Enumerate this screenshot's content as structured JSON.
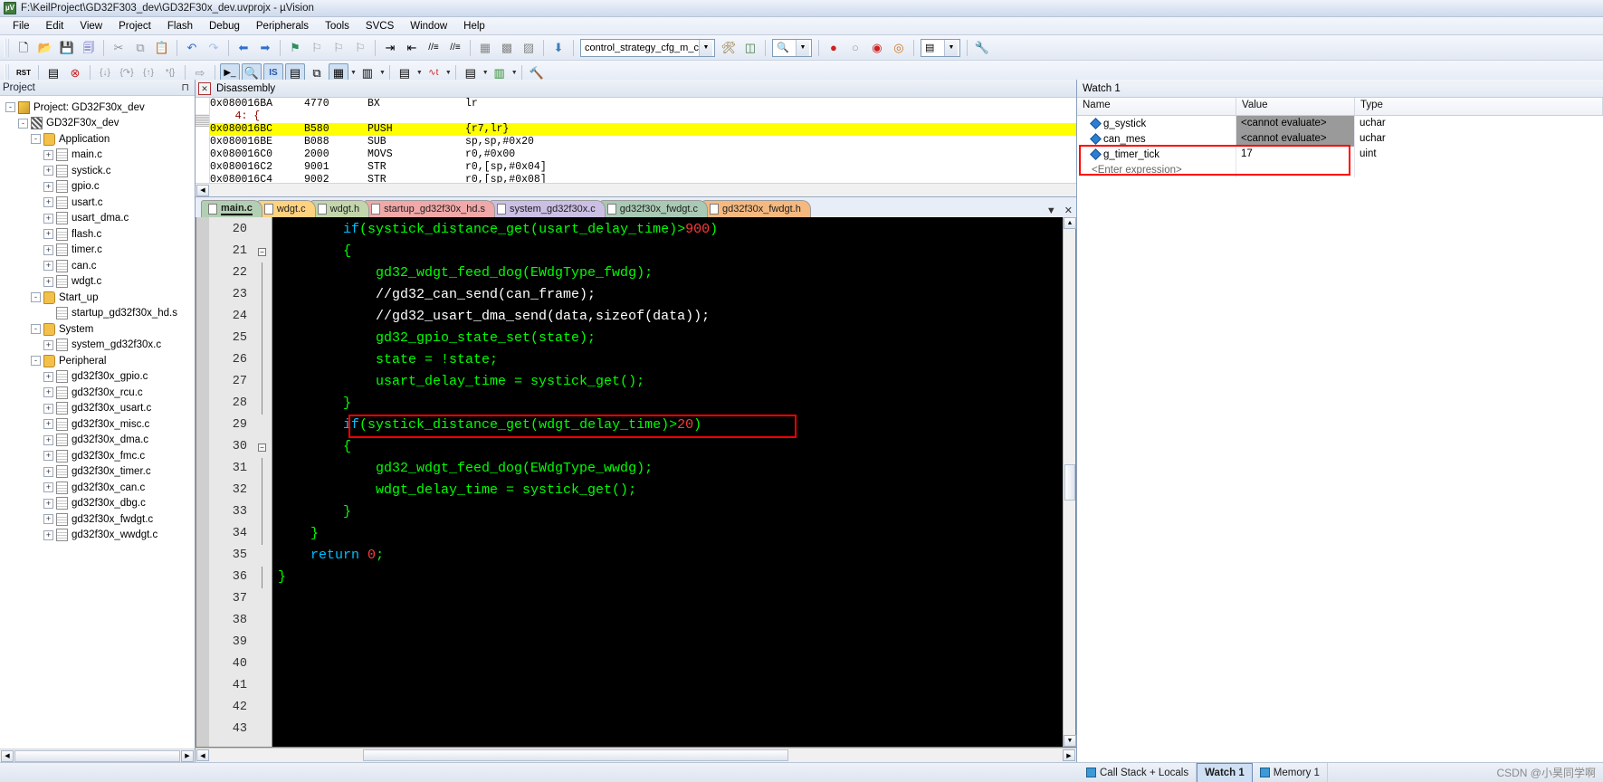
{
  "window": {
    "title": "F:\\KeilProject\\GD32F303_dev\\GD32F30x_dev.uvprojx - µVision",
    "app_icon": "uvision-logo-icon"
  },
  "menubar": {
    "items": [
      "File",
      "Edit",
      "View",
      "Project",
      "Flash",
      "Debug",
      "Peripherals",
      "Tools",
      "SVCS",
      "Window",
      "Help"
    ]
  },
  "toolbar1": {
    "buttons": [
      {
        "name": "new-file-icon",
        "glyph": "🗋",
        "state": "enabled"
      },
      {
        "name": "open-file-icon",
        "glyph": "📂",
        "state": "enabled"
      },
      {
        "name": "save-icon",
        "glyph": "🖫",
        "state": "enabled"
      },
      {
        "name": "save-all-icon",
        "glyph": "🗐",
        "state": "enabled"
      },
      {
        "name": "cut-icon",
        "glyph": "✂",
        "state": "disabled"
      },
      {
        "name": "copy-icon",
        "glyph": "⧉",
        "state": "disabled"
      },
      {
        "name": "paste-icon",
        "glyph": "📋",
        "state": "enabled"
      },
      {
        "name": "undo-icon",
        "glyph": "↶",
        "state": "enabled"
      },
      {
        "name": "redo-icon",
        "glyph": "↷",
        "state": "disabled"
      },
      {
        "name": "navigate-back-icon",
        "glyph": "⬅",
        "state": "enabled"
      },
      {
        "name": "navigate-forward-icon",
        "glyph": "➡",
        "state": "enabled"
      },
      {
        "name": "bookmark-toggle-icon",
        "glyph": "⚑",
        "state": "enabled"
      },
      {
        "name": "bookmark-prev-icon",
        "glyph": "⚐",
        "state": "disabled"
      },
      {
        "name": "bookmark-next-icon",
        "glyph": "⚐",
        "state": "disabled"
      },
      {
        "name": "bookmark-clear-icon",
        "glyph": "⚐",
        "state": "disabled"
      },
      {
        "name": "indent-icon",
        "glyph": "⇥",
        "state": "enabled"
      },
      {
        "name": "outdent-icon",
        "glyph": "⇤",
        "state": "enabled"
      },
      {
        "name": "comment-icon",
        "glyph": "//",
        "state": "enabled"
      },
      {
        "name": "uncomment-icon",
        "glyph": "//",
        "state": "enabled"
      }
    ],
    "target_combo": {
      "value": "control_strategy_cfg_m_c",
      "name": "target-select"
    },
    "right_buttons": [
      {
        "name": "target-options-icon",
        "glyph": "🛠",
        "state": "enabled"
      },
      {
        "name": "manage-runtime-icon",
        "glyph": "◫",
        "state": "enabled"
      },
      {
        "name": "find-in-files-icon",
        "glyph": "🔍",
        "state": "enabled"
      },
      {
        "name": "breakpoint-insert-icon",
        "glyph": "●",
        "state": "enabled"
      },
      {
        "name": "breakpoint-disable-icon",
        "glyph": "○",
        "state": "enabled"
      },
      {
        "name": "breakpoint-kill-all-icon",
        "glyph": "◉",
        "state": "enabled"
      },
      {
        "name": "breakpoint-disable-all-icon",
        "glyph": "◎",
        "state": "enabled"
      },
      {
        "name": "debug-window-icon",
        "glyph": "▤",
        "state": "enabled"
      },
      {
        "name": "configuration-wizard-icon",
        "glyph": "🔧",
        "state": "enabled"
      }
    ]
  },
  "toolbar2": {
    "buttons": [
      {
        "name": "reset-cpu-icon",
        "glyph": "RST",
        "state": "enabled"
      },
      {
        "name": "run-to-cursor-icon",
        "glyph": "▤",
        "state": "enabled"
      },
      {
        "name": "stop-debug-icon",
        "glyph": "✖",
        "state": "enabled"
      },
      {
        "name": "step-icon",
        "glyph": "{}",
        "state": "disabled"
      },
      {
        "name": "step-over-icon",
        "glyph": "{}",
        "state": "disabled"
      },
      {
        "name": "step-out-icon",
        "glyph": "{}",
        "state": "disabled"
      },
      {
        "name": "run-to-line-icon",
        "glyph": "*{}",
        "state": "disabled"
      },
      {
        "name": "show-next-statement-icon",
        "glyph": "⇨",
        "state": "disabled"
      },
      {
        "name": "command-window-icon",
        "glyph": "▶_",
        "state": "pressed"
      },
      {
        "name": "disassembly-window-icon",
        "glyph": "🔎",
        "state": "pressed"
      },
      {
        "name": "symbols-window-icon",
        "glyph": "IS",
        "state": "pressed"
      },
      {
        "name": "registers-window-icon",
        "glyph": "▤",
        "state": "pressed"
      },
      {
        "name": "call-stack-window-icon",
        "glyph": "⧉",
        "state": "enabled"
      },
      {
        "name": "watch-windows-icon",
        "glyph": "▦",
        "state": "pressed"
      },
      {
        "name": "memory-windows-icon",
        "glyph": "▦",
        "state": "enabled"
      },
      {
        "name": "serial-windows-icon",
        "glyph": "▤",
        "state": "enabled"
      },
      {
        "name": "analysis-windows-icon",
        "glyph": "∿t",
        "state": "enabled"
      },
      {
        "name": "trace-windows-icon",
        "glyph": "▤",
        "state": "enabled"
      },
      {
        "name": "system-viewer-icon",
        "glyph": "▥",
        "state": "enabled"
      },
      {
        "name": "toolbox-icon",
        "glyph": "🔨",
        "state": "enabled"
      }
    ]
  },
  "project_panel": {
    "title": "Project",
    "pin_icon": "pin-icon",
    "tree": [
      {
        "label": "Project: GD32F30x_dev",
        "indent": 0,
        "icon": "project-icon",
        "expander": "-"
      },
      {
        "label": "GD32F30x_dev",
        "indent": 1,
        "icon": "target-icon",
        "expander": "-"
      },
      {
        "label": "Application",
        "indent": 2,
        "icon": "folder-icon",
        "expander": "-"
      },
      {
        "label": "main.c",
        "indent": 3,
        "icon": "c-file-icon",
        "expander": "+"
      },
      {
        "label": "systick.c",
        "indent": 3,
        "icon": "c-file-icon",
        "expander": "+"
      },
      {
        "label": "gpio.c",
        "indent": 3,
        "icon": "c-file-icon",
        "expander": "+"
      },
      {
        "label": "usart.c",
        "indent": 3,
        "icon": "c-file-icon",
        "expander": "+"
      },
      {
        "label": "usart_dma.c",
        "indent": 3,
        "icon": "c-file-icon",
        "expander": "+"
      },
      {
        "label": "flash.c",
        "indent": 3,
        "icon": "c-file-icon",
        "expander": "+"
      },
      {
        "label": "timer.c",
        "indent": 3,
        "icon": "c-file-icon",
        "expander": "+"
      },
      {
        "label": "can.c",
        "indent": 3,
        "icon": "c-file-icon",
        "expander": "+"
      },
      {
        "label": "wdgt.c",
        "indent": 3,
        "icon": "c-file-icon",
        "expander": "+"
      },
      {
        "label": "Start_up",
        "indent": 2,
        "icon": "folder-icon",
        "expander": "-"
      },
      {
        "label": "startup_gd32f30x_hd.s",
        "indent": 3,
        "icon": "asm-file-icon",
        "expander": ""
      },
      {
        "label": "System",
        "indent": 2,
        "icon": "folder-icon",
        "expander": "-"
      },
      {
        "label": "system_gd32f30x.c",
        "indent": 3,
        "icon": "c-file-icon",
        "expander": "+"
      },
      {
        "label": "Peripheral",
        "indent": 2,
        "icon": "folder-icon",
        "expander": "-"
      },
      {
        "label": "gd32f30x_gpio.c",
        "indent": 3,
        "icon": "c-file-icon",
        "expander": "+"
      },
      {
        "label": "gd32f30x_rcu.c",
        "indent": 3,
        "icon": "c-file-icon",
        "expander": "+"
      },
      {
        "label": "gd32f30x_usart.c",
        "indent": 3,
        "icon": "c-file-icon",
        "expander": "+"
      },
      {
        "label": "gd32f30x_misc.c",
        "indent": 3,
        "icon": "c-file-icon",
        "expander": "+"
      },
      {
        "label": "gd32f30x_dma.c",
        "indent": 3,
        "icon": "c-file-icon",
        "expander": "+"
      },
      {
        "label": "gd32f30x_fmc.c",
        "indent": 3,
        "icon": "c-file-icon",
        "expander": "+"
      },
      {
        "label": "gd32f30x_timer.c",
        "indent": 3,
        "icon": "c-file-icon",
        "expander": "+"
      },
      {
        "label": "gd32f30x_can.c",
        "indent": 3,
        "icon": "c-file-icon",
        "expander": "+"
      },
      {
        "label": "gd32f30x_dbg.c",
        "indent": 3,
        "icon": "c-file-icon",
        "expander": "+"
      },
      {
        "label": "gd32f30x_fwdgt.c",
        "indent": 3,
        "icon": "c-file-icon",
        "expander": "+"
      },
      {
        "label": "gd32f30x_wwdgt.c",
        "indent": 3,
        "icon": "c-file-icon",
        "expander": "+"
      }
    ]
  },
  "disassembly": {
    "title": "Disassembly",
    "close_icon": "close-icon",
    "rows": [
      {
        "addr": "0x080016BA",
        "hex": "4770",
        "mnem": "BX",
        "ops": "lr",
        "current": false,
        "source": false
      },
      {
        "addr": "",
        "hex": "",
        "mnem": "",
        "ops": "",
        "current": false,
        "source": true,
        "text": "    4: {"
      },
      {
        "addr": "0x080016BC",
        "hex": "B580",
        "mnem": "PUSH",
        "ops": "{r7,lr}",
        "current": true,
        "source": false
      },
      {
        "addr": "0x080016BE",
        "hex": "B088",
        "mnem": "SUB",
        "ops": "sp,sp,#0x20",
        "current": false,
        "source": false
      },
      {
        "addr": "0x080016C0",
        "hex": "2000",
        "mnem": "MOVS",
        "ops": "r0,#0x00",
        "current": false,
        "source": false
      },
      {
        "addr": "0x080016C2",
        "hex": "9001",
        "mnem": "STR",
        "ops": "r0,[sp,#0x04]",
        "current": false,
        "source": false
      },
      {
        "addr": "0x080016C4",
        "hex": "9002",
        "mnem": "STR",
        "ops": "r0,[sp,#0x08]",
        "current": false,
        "source": false
      }
    ]
  },
  "editor": {
    "tabs": [
      {
        "label": "main.c",
        "color": "#b3cfb3",
        "active": true
      },
      {
        "label": "wdgt.c",
        "color": "#ffd27f",
        "active": false
      },
      {
        "label": "wdgt.h",
        "color": "#c3d5ab",
        "active": false
      },
      {
        "label": "startup_gd32f30x_hd.s",
        "color": "#f0a8a8",
        "active": false
      },
      {
        "label": "system_gd32f30x.c",
        "color": "#cbbfe4",
        "active": false
      },
      {
        "label": "gd32f30x_fwdgt.c",
        "color": "#a9c9b4",
        "active": false
      },
      {
        "label": "gd32f30x_fwdgt.h",
        "color": "#f5b980",
        "active": false
      }
    ],
    "tab_menu_icon": "chevron-down-icon",
    "tab_close_icon": "close-icon",
    "first_line_number": 20,
    "lines": [
      {
        "n": 20,
        "fold": "",
        "tokens": [
          {
            "t": "        ",
            "c": "plain"
          },
          {
            "t": "if",
            "c": "kw"
          },
          {
            "t": "(systick_distance_get(usart_delay_time)>",
            "c": "plain"
          },
          {
            "t": "900",
            "c": "num"
          },
          {
            "t": ")",
            "c": "plain"
          }
        ]
      },
      {
        "n": 21,
        "fold": "box",
        "tokens": [
          {
            "t": "        {",
            "c": "plain"
          }
        ]
      },
      {
        "n": 22,
        "fold": "line",
        "tokens": [
          {
            "t": "            gd32_wdgt_feed_dog(EWdgType_fwdg);",
            "c": "plain"
          }
        ]
      },
      {
        "n": 23,
        "fold": "line",
        "tokens": [
          {
            "t": "            //gd32_can_send(can_frame);",
            "c": "cmt"
          }
        ]
      },
      {
        "n": 24,
        "fold": "line",
        "tokens": [
          {
            "t": "            //gd32_usart_dma_send(data,sizeof(data));",
            "c": "cmt"
          }
        ]
      },
      {
        "n": 25,
        "fold": "line",
        "tokens": [
          {
            "t": "            gd32_gpio_state_set(state);",
            "c": "plain"
          }
        ]
      },
      {
        "n": 26,
        "fold": "line",
        "tokens": [
          {
            "t": "            state = !state;",
            "c": "plain"
          }
        ]
      },
      {
        "n": 27,
        "fold": "line",
        "tokens": [
          {
            "t": "            usart_delay_time = systick_get();",
            "c": "plain"
          }
        ]
      },
      {
        "n": 28,
        "fold": "end",
        "tokens": [
          {
            "t": "        }",
            "c": "plain"
          }
        ]
      },
      {
        "n": 29,
        "fold": "",
        "tokens": [
          {
            "t": "        ",
            "c": "plain"
          },
          {
            "t": "if",
            "c": "kw"
          },
          {
            "t": "(systick_distance_get(wdgt_delay_time)>",
            "c": "plain"
          },
          {
            "t": "20",
            "c": "num"
          },
          {
            "t": ")",
            "c": "plain"
          }
        ]
      },
      {
        "n": 30,
        "fold": "box",
        "tokens": [
          {
            "t": "        {",
            "c": "plain"
          }
        ]
      },
      {
        "n": 31,
        "fold": "line",
        "tokens": [
          {
            "t": "            gd32_wdgt_feed_dog(EWdgType_wwdg);",
            "c": "plain"
          }
        ]
      },
      {
        "n": 32,
        "fold": "line",
        "tokens": [
          {
            "t": "            wdgt_delay_time = systick_get();",
            "c": "plain"
          }
        ]
      },
      {
        "n": 33,
        "fold": "end",
        "tokens": [
          {
            "t": "        }",
            "c": "plain"
          }
        ]
      },
      {
        "n": 34,
        "fold": "end",
        "tokens": [
          {
            "t": "    }",
            "c": "plain"
          }
        ]
      },
      {
        "n": 35,
        "fold": "",
        "tokens": [
          {
            "t": "    ",
            "c": "plain"
          },
          {
            "t": "return",
            "c": "kw"
          },
          {
            "t": " ",
            "c": "plain"
          },
          {
            "t": "0",
            "c": "num"
          },
          {
            "t": ";",
            "c": "plain"
          }
        ]
      },
      {
        "n": 36,
        "fold": "end",
        "tokens": [
          {
            "t": "}",
            "c": "plain"
          }
        ]
      },
      {
        "n": 37,
        "fold": "",
        "tokens": [
          {
            "t": "",
            "c": "plain"
          }
        ]
      },
      {
        "n": 38,
        "fold": "",
        "tokens": [
          {
            "t": "",
            "c": "plain"
          }
        ]
      },
      {
        "n": 39,
        "fold": "",
        "tokens": [
          {
            "t": "",
            "c": "plain"
          }
        ]
      },
      {
        "n": 40,
        "fold": "",
        "tokens": [
          {
            "t": "",
            "c": "plain"
          }
        ]
      },
      {
        "n": 41,
        "fold": "",
        "tokens": [
          {
            "t": "",
            "c": "plain"
          }
        ]
      },
      {
        "n": 42,
        "fold": "",
        "tokens": [
          {
            "t": "",
            "c": "plain"
          }
        ]
      },
      {
        "n": 43,
        "fold": "",
        "tokens": [
          {
            "t": "",
            "c": "plain"
          }
        ]
      }
    ],
    "highlight_box": {
      "line": 29,
      "color": "#ff0000"
    },
    "colors": {
      "background": "#000000",
      "text": "#00ff00",
      "keyword": "#00bfff",
      "number": "#ff3b3b",
      "comment": "#ffffff"
    }
  },
  "watch": {
    "title": "Watch 1",
    "columns": [
      "Name",
      "Value",
      "Type"
    ],
    "rows": [
      {
        "name": "g_systick",
        "value": "<cannot evaluate>",
        "type": "uchar",
        "value_grey": true
      },
      {
        "name": "can_mes",
        "value": "<cannot evaluate>",
        "type": "uchar",
        "value_grey": true
      },
      {
        "name": "g_timer_tick",
        "value": "17",
        "type": "uint",
        "value_grey": false
      },
      {
        "name": "<Enter expression>",
        "value": "",
        "type": "",
        "value_grey": false,
        "placeholder": true
      }
    ],
    "highlight_color": "#ff0000"
  },
  "statusbar": {
    "tabs": [
      {
        "label": "Call Stack + Locals",
        "icon": "call-stack-icon",
        "active": false
      },
      {
        "label": "Watch 1",
        "icon": "watch-icon",
        "active": true
      },
      {
        "label": "Memory 1",
        "icon": "memory-icon",
        "active": false
      }
    ],
    "watermark": "CSDN @小昊同学啊"
  }
}
